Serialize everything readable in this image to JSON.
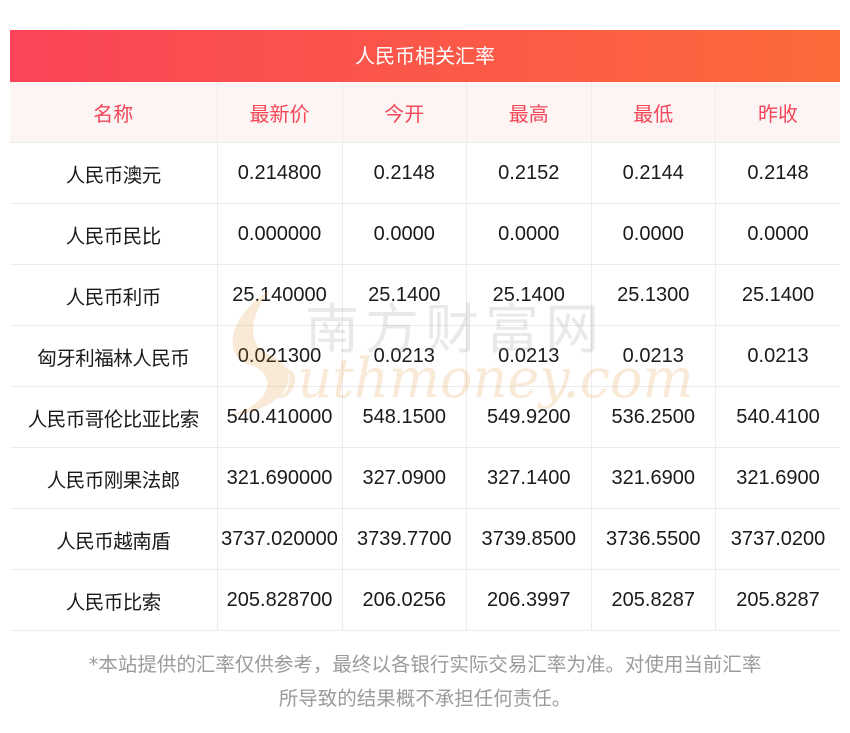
{
  "title": "人民币相关汇率",
  "columns": [
    "名称",
    "最新价",
    "今开",
    "最高",
    "最低",
    "昨收"
  ],
  "rows": [
    [
      "人民币澳元",
      "0.214800",
      "0.2148",
      "0.2152",
      "0.2144",
      "0.2148"
    ],
    [
      "人民币民比",
      "0.000000",
      "0.0000",
      "0.0000",
      "0.0000",
      "0.0000"
    ],
    [
      "人民币利币",
      "25.140000",
      "25.1400",
      "25.1400",
      "25.1300",
      "25.1400"
    ],
    [
      "匈牙利福林人民币",
      "0.021300",
      "0.0213",
      "0.0213",
      "0.0213",
      "0.0213"
    ],
    [
      "人民币哥伦比亚比索",
      "540.410000",
      "548.1500",
      "549.9200",
      "536.2500",
      "540.4100"
    ],
    [
      "人民币刚果法郎",
      "321.690000",
      "327.0900",
      "327.1400",
      "321.6900",
      "321.6900"
    ],
    [
      "人民币越南盾",
      "3737.020000",
      "3739.7700",
      "3739.8500",
      "3736.5500",
      "3737.0200"
    ],
    [
      "人民币比索",
      "205.828700",
      "206.0256",
      "206.3997",
      "205.8287",
      "205.8287"
    ]
  ],
  "watermark": {
    "cn": "南方财富网",
    "en": "outhmoney.com"
  },
  "footnote": {
    "line1": "*本站提供的汇率仅供参考，最终以各银行实际交易汇率为准。对使用当前汇率",
    "line2": "所导致的结果概不承担任何责任。"
  },
  "colors": {
    "title_start": "#fb4458",
    "title_end": "#fb6a3a",
    "header_text": "#f5475a",
    "header_bg": "#fdf4f4"
  }
}
